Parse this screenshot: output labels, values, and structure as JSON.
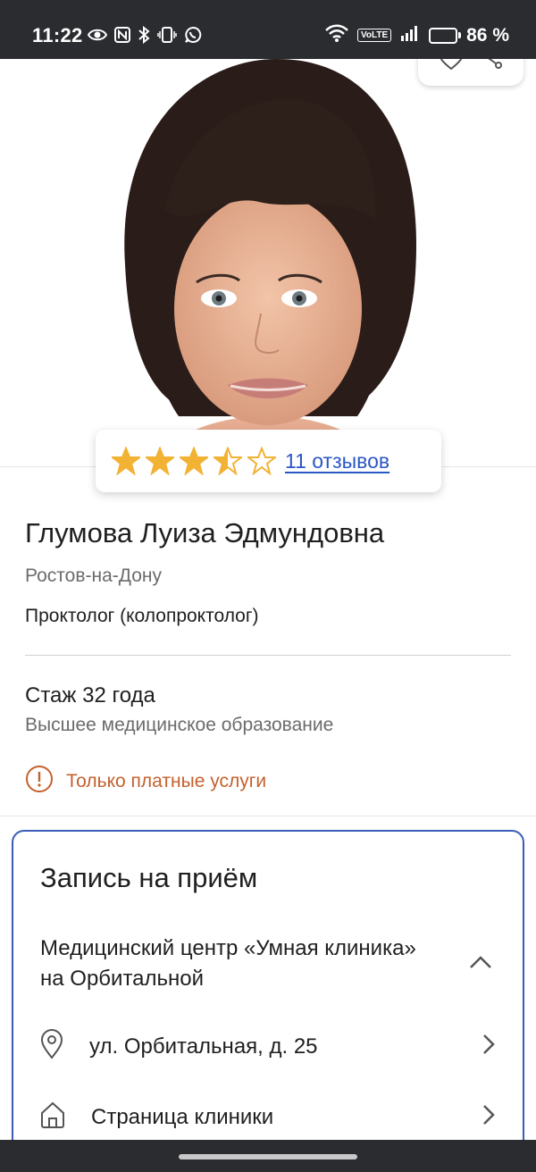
{
  "status_bar": {
    "time": "11:22",
    "volte": "VoLTE",
    "battery_percent": "86 %",
    "battery_level": 0.86
  },
  "photo": {
    "description_icon": "doctor-portrait"
  },
  "actions": {
    "favorite_icon": "heart-icon",
    "share_icon": "share-icon"
  },
  "rating": {
    "value": 3.5,
    "max": 5,
    "reviews_link": "11 отзывов",
    "star_color": "#f2b234"
  },
  "doctor": {
    "name": "Глумова Луиза Эдмундовна",
    "city": "Ростов-на-Дону",
    "specialty": "Проктолог (колопроктолог)",
    "experience": "Стаж 32 года",
    "education": "Высшее медицинское образование",
    "paid_only": "Только платные услуги"
  },
  "booking": {
    "title": "Запись на приём",
    "clinic_name": "Медицинский центр «Умная клиника» на Орбитальной",
    "address": "ул. Орбитальная, д. 25",
    "clinic_page": "Страница клиники"
  },
  "colors": {
    "accent": "#2b56c6",
    "warning": "#c4612e",
    "card_border": "#3a5cb8"
  }
}
